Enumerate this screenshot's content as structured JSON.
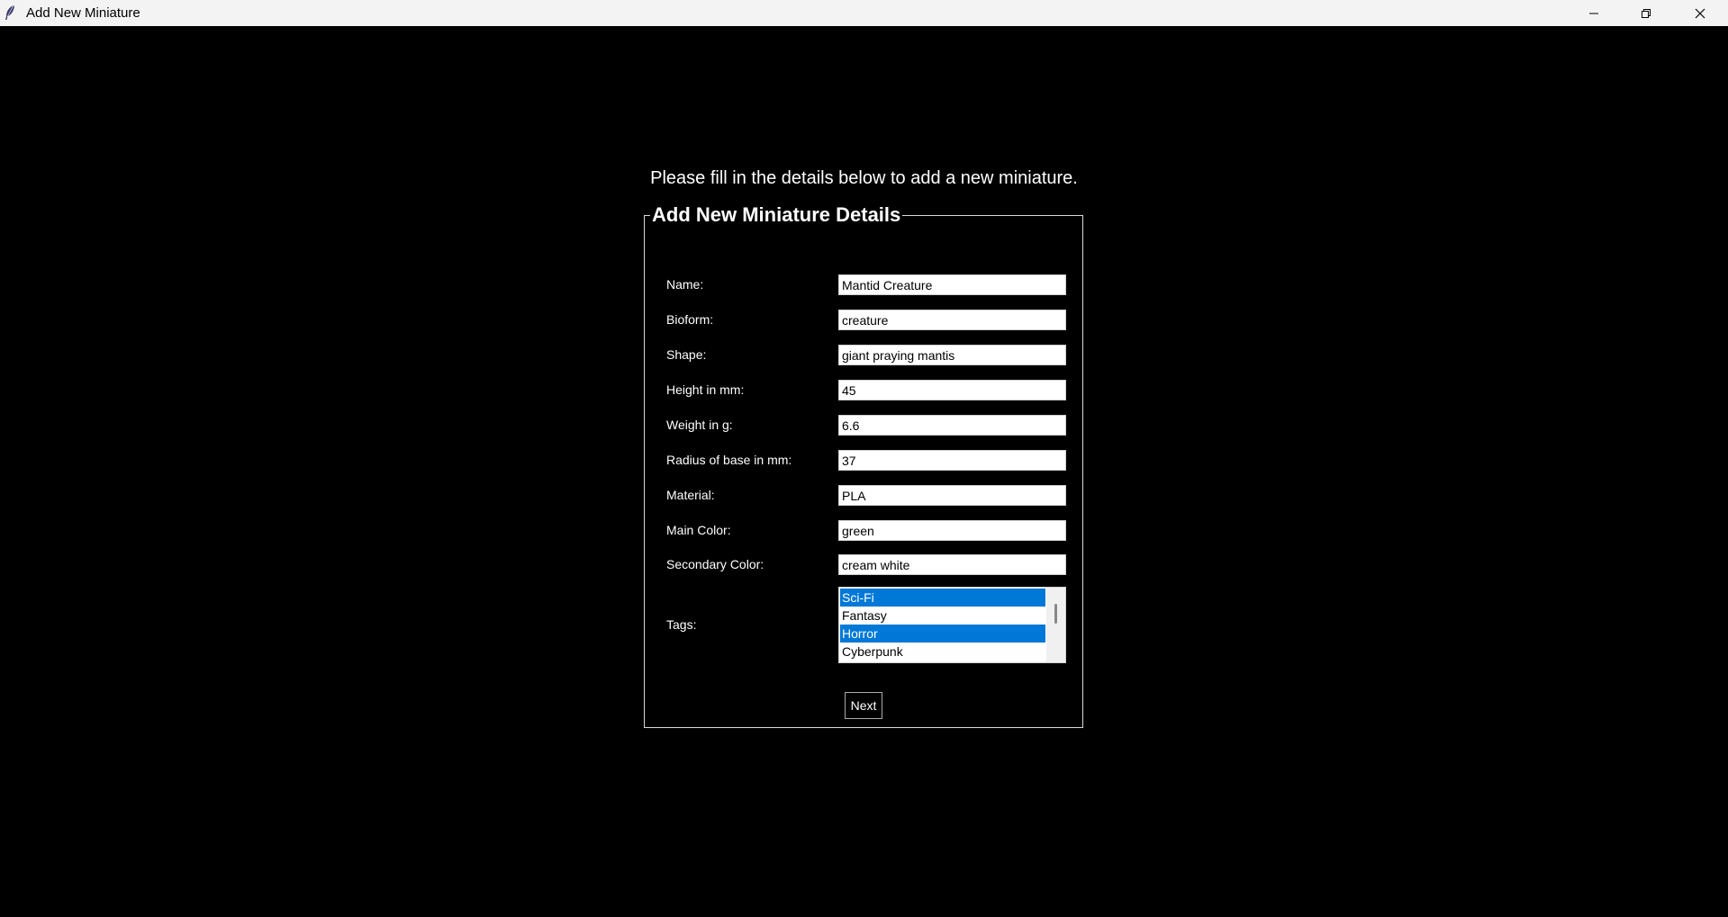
{
  "window": {
    "title": "Add New Miniature",
    "icon": "feather-icon"
  },
  "instructions": "Please fill in the details below to add a new miniature.",
  "form": {
    "legend": "Add New Miniature Details",
    "fields": [
      {
        "label": "Name:",
        "value": "Mantid Creature"
      },
      {
        "label": "Bioform:",
        "value": "creature"
      },
      {
        "label": "Shape:",
        "value": "giant praying mantis"
      },
      {
        "label": "Height in mm:",
        "value": "45"
      },
      {
        "label": "Weight in g:",
        "value": "6.6"
      },
      {
        "label": "Radius of base in mm:",
        "value": "37"
      },
      {
        "label": "Material:",
        "value": "PLA"
      },
      {
        "label": "Main Color:",
        "value": "green"
      },
      {
        "label": "Secondary Color:",
        "value": "cream white"
      }
    ],
    "tags": {
      "label": "Tags:",
      "options": [
        {
          "label": "Sci-Fi",
          "selected": true
        },
        {
          "label": "Fantasy",
          "selected": false
        },
        {
          "label": "Horror",
          "selected": true
        },
        {
          "label": "Cyberpunk",
          "selected": false
        }
      ]
    },
    "next_label": "Next"
  },
  "colors": {
    "background": "#000000",
    "selection": "#0078d7",
    "titlebar": "#f3f3f3"
  }
}
